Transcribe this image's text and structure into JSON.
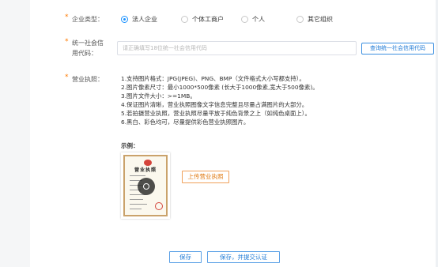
{
  "enterprise_type": {
    "required_mark": "*",
    "label": "企业类型：",
    "options": [
      {
        "label": "法人企业",
        "selected": true
      },
      {
        "label": "个体工商户",
        "selected": false
      },
      {
        "label": "个人",
        "selected": false
      },
      {
        "label": "其它组织",
        "selected": false
      }
    ]
  },
  "credit_code": {
    "required_mark": "*",
    "label_line1": "统一社会信",
    "label_line2": "用代码：",
    "placeholder": "请正确填写18位统一社会信用代码",
    "value": "",
    "query_button": "查询统一社会信用代码"
  },
  "business_license": {
    "required_mark": "*",
    "label": "营业执照：",
    "requirements": [
      "1.支持图片格式：JPG(JPEG)、PNG、BMP（文件格式大小写都支持）。",
      "2.图片像素尺寸：最小1000*500像素 (长大于1000像素,宽大于500像素)。",
      "3.图片文件大小：>=1MB。",
      "4.保证图片清晰，营业执照图像文字信息完整且尽量占满图片的大部分。",
      "5.若拍摄营业执照，营业执照尽量平放于纯色背景之上（如纯色桌面上）。",
      "6.黑白、彩色均可，尽量提供彩色营业执照图片。"
    ],
    "example_label": "示例：",
    "sample_title": "营业执照",
    "upload_button": "上传营业执照"
  },
  "actions": {
    "save": "保存",
    "save_submit": "保存，并提交认证"
  },
  "colors": {
    "accent": "#1890ff",
    "required": "#ff7a00",
    "upload": "#e07a12"
  }
}
